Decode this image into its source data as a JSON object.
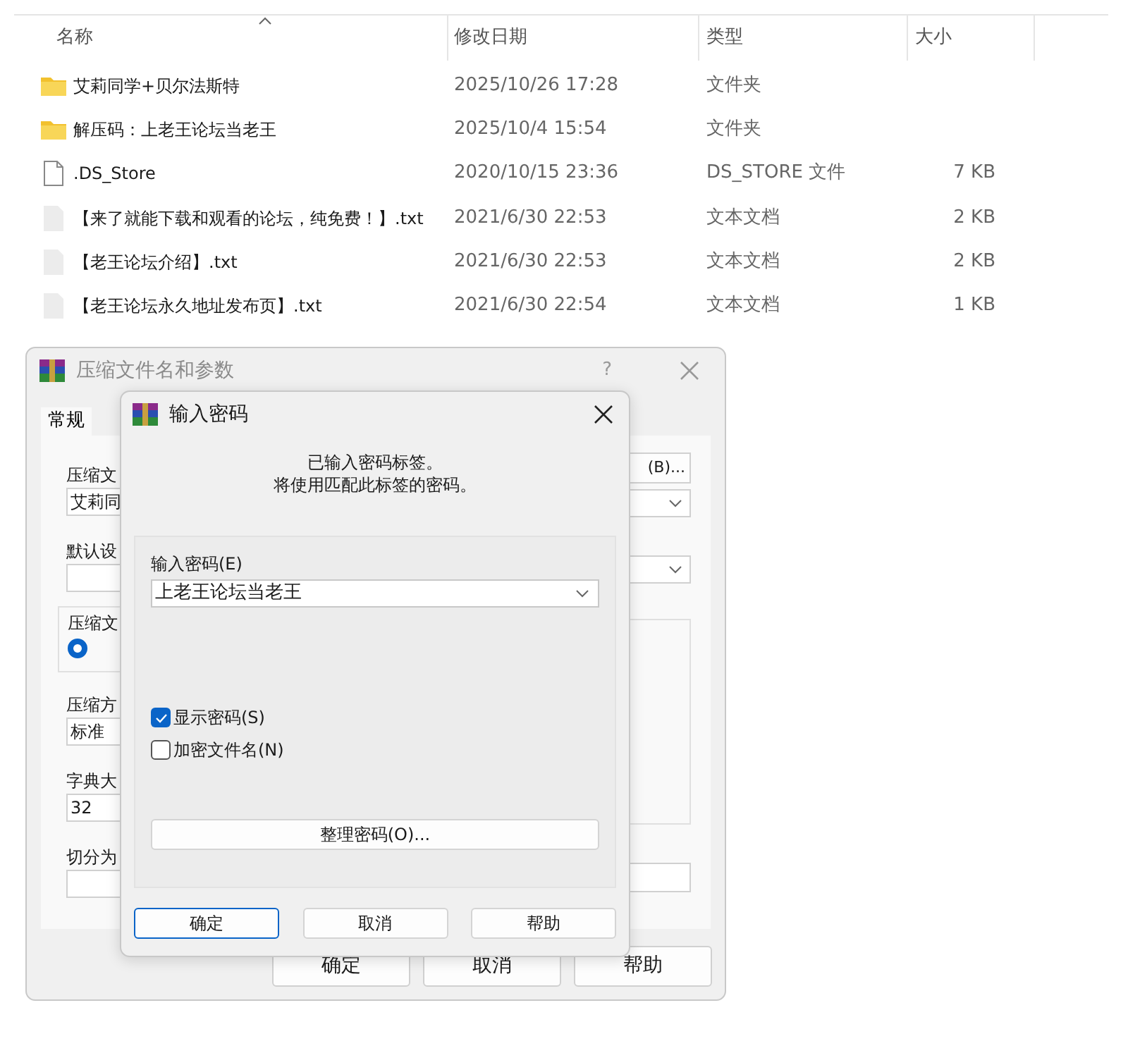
{
  "file_list": {
    "columns": [
      {
        "label": "名称",
        "sorted": true
      },
      {
        "label": "修改日期",
        "sorted": false
      },
      {
        "label": "类型",
        "sorted": false
      },
      {
        "label": "大小",
        "sorted": false
      }
    ],
    "rows": [
      {
        "kind": "folder",
        "name": "艾莉同学+贝尔法斯特",
        "modified": "2025/10/26 17:28",
        "type": "文件夹"
      },
      {
        "kind": "folder",
        "name": "解压码：上老王论坛当老王",
        "modified": "2025/10/4 15:54",
        "type": "文件夹"
      },
      {
        "kind": "file",
        "name": ".DS_Store",
        "modified": "2020/10/15 23:36",
        "type": "DS_STORE 文件",
        "size": "7 KB"
      },
      {
        "kind": "text",
        "name": "【来了就能下载和观看的论坛，纯免费！】.txt",
        "modified": "2021/6/30 22:53",
        "type": "文本文档",
        "size": "2 KB"
      },
      {
        "kind": "text",
        "name": "【老王论坛介绍】.txt",
        "modified": "2021/6/30 22:53",
        "type": "文本文档",
        "size": "2 KB"
      },
      {
        "kind": "text",
        "name": "【老王论坛永久地址发布页】.txt",
        "modified": "2021/6/30 22:54",
        "type": "文本文档",
        "size": "1 KB"
      }
    ]
  },
  "archive_dialog": {
    "title": "压缩文件名和参数",
    "help": "?",
    "tabs": [
      {
        "label": "常规",
        "selected": true
      }
    ],
    "left_items": [
      {
        "kind": "label",
        "text": "压缩文"
      },
      {
        "kind": "field",
        "value": "艾莉同"
      },
      {
        "kind": "label",
        "text": "默认设"
      },
      {
        "kind": "field"
      },
      {
        "kind": "group",
        "text": "压缩文",
        "selected": true
      },
      {
        "kind": "label",
        "text": "压缩方"
      },
      {
        "kind": "field",
        "value": "标准"
      },
      {
        "kind": "label",
        "text": "字典大"
      },
      {
        "kind": "field",
        "value": "32"
      },
      {
        "kind": "label",
        "text": "切分为"
      },
      {
        "kind": "field"
      }
    ],
    "browse_button": "(B)...",
    "buttons": [
      "确定",
      "取消",
      "帮助"
    ]
  },
  "password_dialog": {
    "title": "输入密码",
    "message": [
      "已输入密码标签。",
      "将使用匹配此标签的密码。"
    ],
    "password_label": "输入密码(E)",
    "password_value": "上老王论坛当老王",
    "options": [
      {
        "label": "显示密码(S)",
        "checked": true
      },
      {
        "label": "加密文件名(N)",
        "checked": false
      }
    ],
    "organize_button": "整理密码(O)...",
    "buttons": [
      {
        "label": "确定",
        "default": true
      },
      {
        "label": "取消",
        "default": false
      },
      {
        "label": "帮助",
        "default": false
      }
    ]
  }
}
